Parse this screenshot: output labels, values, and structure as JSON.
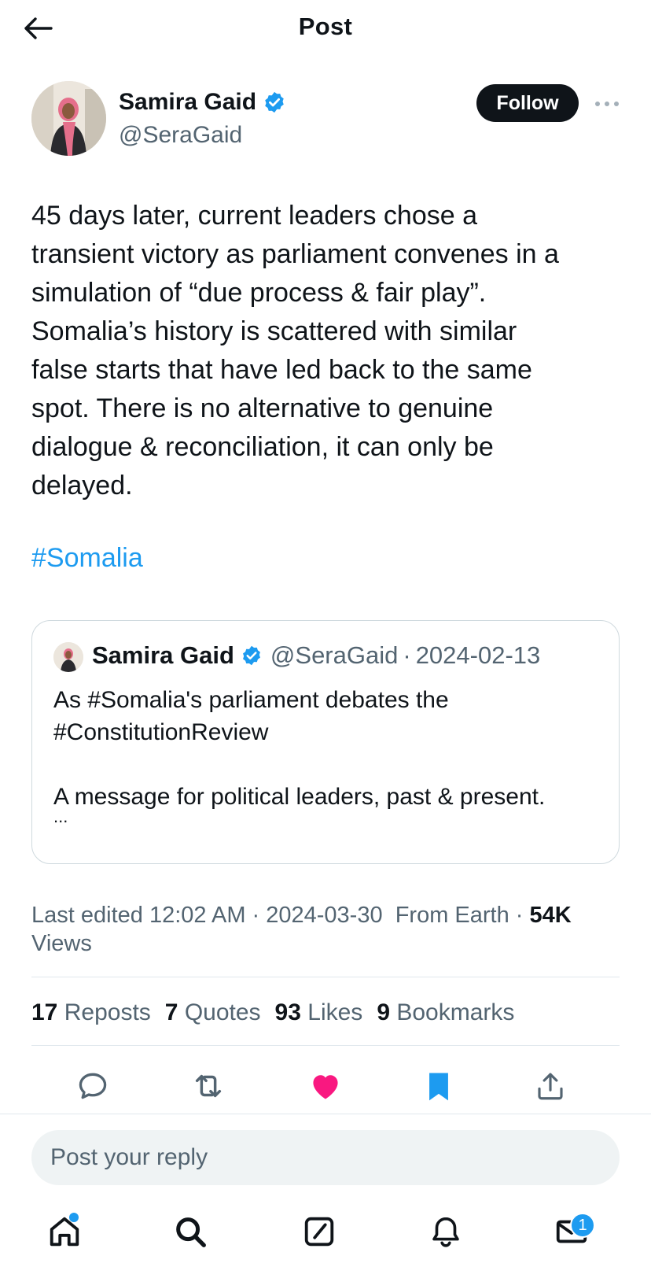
{
  "header": {
    "title": "Post"
  },
  "author": {
    "name": "Samira Gaid",
    "handle": "@SeraGaid",
    "follow_label": "Follow"
  },
  "post": {
    "text": "45 days later, current leaders chose a\ntransient victory as parliament convenes in a\nsimulation of “due process & fair play”.\nSomalia’s history is scattered with similar\nfalse starts that have led back to the same\nspot. There is no alternative to genuine\ndialogue & reconciliation, it can only be\ndelayed.",
    "hashtag": "#Somalia"
  },
  "quote": {
    "name": "Samira Gaid",
    "handle": "@SeraGaid",
    "separator": "·",
    "date": "2024-02-13",
    "text": "As #Somalia's parliament debates the\n#ConstitutionReview\n\nA message for political leaders, past & present.",
    "ellipsis": "..."
  },
  "meta": {
    "edited": "Last edited 12:02 AM · 2024-03-30",
    "source": "From Earth ·",
    "views_count": "54K",
    "views_label": "Views"
  },
  "stats": [
    {
      "count": "17",
      "label": "Reposts"
    },
    {
      "count": "7",
      "label": "Quotes"
    },
    {
      "count": "93",
      "label": "Likes"
    },
    {
      "count": "9",
      "label": "Bookmarks"
    }
  ],
  "actions": [
    "reply-icon",
    "repost-icon",
    "like-icon",
    "bookmark-icon",
    "share-icon"
  ],
  "reply": {
    "placeholder": "Post your reply"
  },
  "tabbar": {
    "items": [
      "home-icon",
      "search-icon",
      "compose-icon",
      "notifications-icon",
      "messages-icon"
    ],
    "messages_badge": "1"
  },
  "colors": {
    "accent": "#1d9bf0",
    "like": "#f91880",
    "text": "#0f1419",
    "muted": "#536471"
  }
}
